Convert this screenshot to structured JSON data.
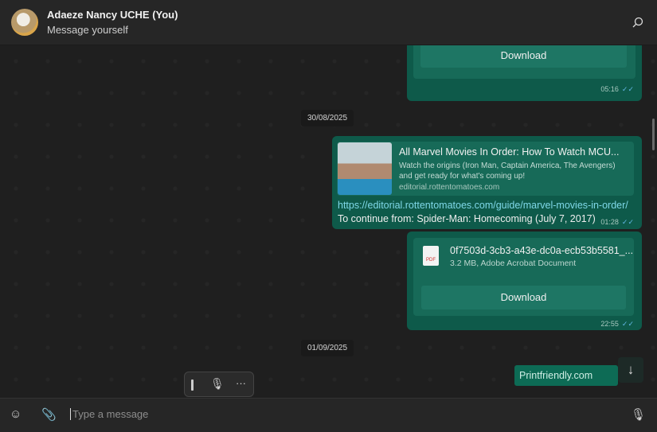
{
  "header": {
    "name": "Adaeze Nancy UCHE (You)",
    "subtitle": "Message yourself"
  },
  "messages": {
    "top_download": {
      "button": "Download",
      "time": "05:16"
    },
    "date1": "30/08/2025",
    "link": {
      "title": "All Marvel Movies In Order: How To Watch MCU...",
      "description": "Watch the origins (Iron Man, Captain America, The Avengers) and get ready for what's coming up!",
      "domain": "editorial.rottentomatoes.com",
      "url": "https://editorial.rottentomatoes.com/guide/marvel-movies-in-order/",
      "text": "To continue from: Spider-Man: Homecoming (July 7, 2017)",
      "time": "01:28"
    },
    "file": {
      "name": "0f7503d-3cb3-a43e-dc0a-ecb53b5581_...",
      "meta": "3.2 MB, Adobe Acrobat Document",
      "icon_label": "PDF",
      "button": "Download",
      "time": "22:55"
    },
    "date2": "01/09/2025",
    "last": {
      "text": "Printfriendly.com"
    }
  },
  "composer": {
    "placeholder": "Type a message"
  }
}
